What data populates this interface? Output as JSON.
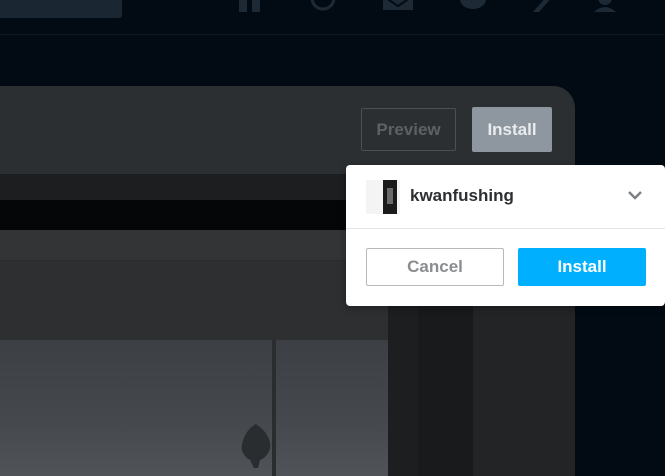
{
  "nav": {
    "icons": [
      "home-icon",
      "explore-icon",
      "inbox-icon",
      "messaging-icon",
      "activity-icon",
      "account-icon"
    ]
  },
  "editor": {
    "preview_label": "Preview",
    "install_label": "Install"
  },
  "install_popover": {
    "account_name": "kwanfushing",
    "cancel_label": "Cancel",
    "install_label": "Install"
  },
  "colors": {
    "accent": "#00b0ff",
    "background": "#020b14",
    "overlay_panel": "#2c2f32"
  }
}
